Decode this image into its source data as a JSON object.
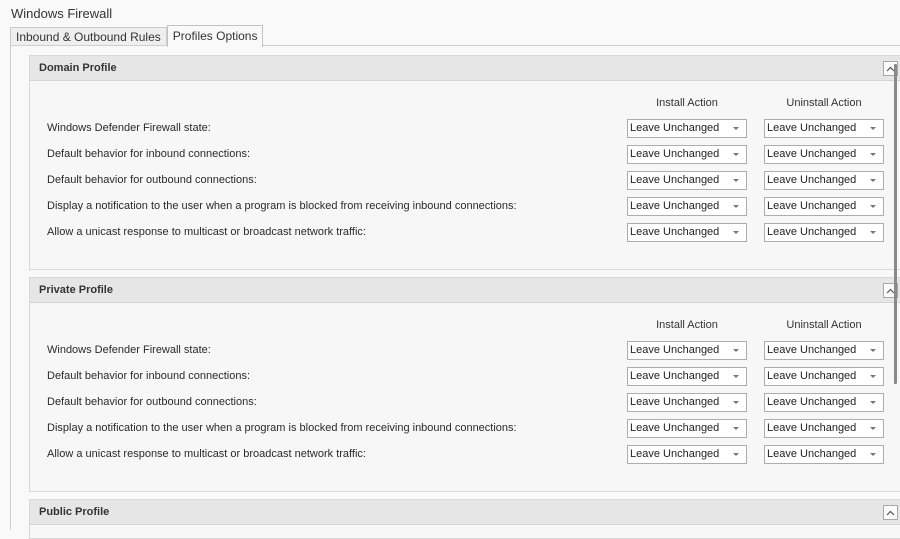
{
  "app_title": "Windows Firewall",
  "tabs": [
    {
      "label": "Inbound & Outbound Rules",
      "active": false
    },
    {
      "label": "Profiles Options",
      "active": true
    }
  ],
  "columns": {
    "install": "Install Action",
    "uninstall": "Uninstall Action"
  },
  "sections": [
    {
      "title": "Domain Profile",
      "expanded": true,
      "collapse_icon": "chevron-up-icon",
      "rows": [
        {
          "label": "Windows Defender Firewall state:",
          "install": "Leave Unchanged",
          "uninstall": "Leave Unchanged"
        },
        {
          "label": "Default behavior for inbound connections:",
          "install": "Leave Unchanged",
          "uninstall": "Leave Unchanged"
        },
        {
          "label": "Default behavior for outbound connections:",
          "install": "Leave Unchanged",
          "uninstall": "Leave Unchanged"
        },
        {
          "label": "Display a notification to the user when a program is blocked from receiving inbound connections:",
          "install": "Leave Unchanged",
          "uninstall": "Leave Unchanged"
        },
        {
          "label": "Allow a unicast response to multicast or broadcast network traffic:",
          "install": "Leave Unchanged",
          "uninstall": "Leave Unchanged"
        }
      ]
    },
    {
      "title": "Private Profile",
      "expanded": true,
      "collapse_icon": "chevron-up-icon",
      "rows": [
        {
          "label": "Windows Defender Firewall state:",
          "install": "Leave Unchanged",
          "uninstall": "Leave Unchanged"
        },
        {
          "label": "Default behavior for inbound connections:",
          "install": "Leave Unchanged",
          "uninstall": "Leave Unchanged"
        },
        {
          "label": "Default behavior for outbound connections:",
          "install": "Leave Unchanged",
          "uninstall": "Leave Unchanged"
        },
        {
          "label": "Display a notification to the user when a program is blocked from receiving inbound connections:",
          "install": "Leave Unchanged",
          "uninstall": "Leave Unchanged"
        },
        {
          "label": "Allow a unicast response to multicast or broadcast network traffic:",
          "install": "Leave Unchanged",
          "uninstall": "Leave Unchanged"
        }
      ]
    },
    {
      "title": "Public Profile",
      "expanded": true,
      "collapse_icon": "chevron-up-icon"
    }
  ]
}
